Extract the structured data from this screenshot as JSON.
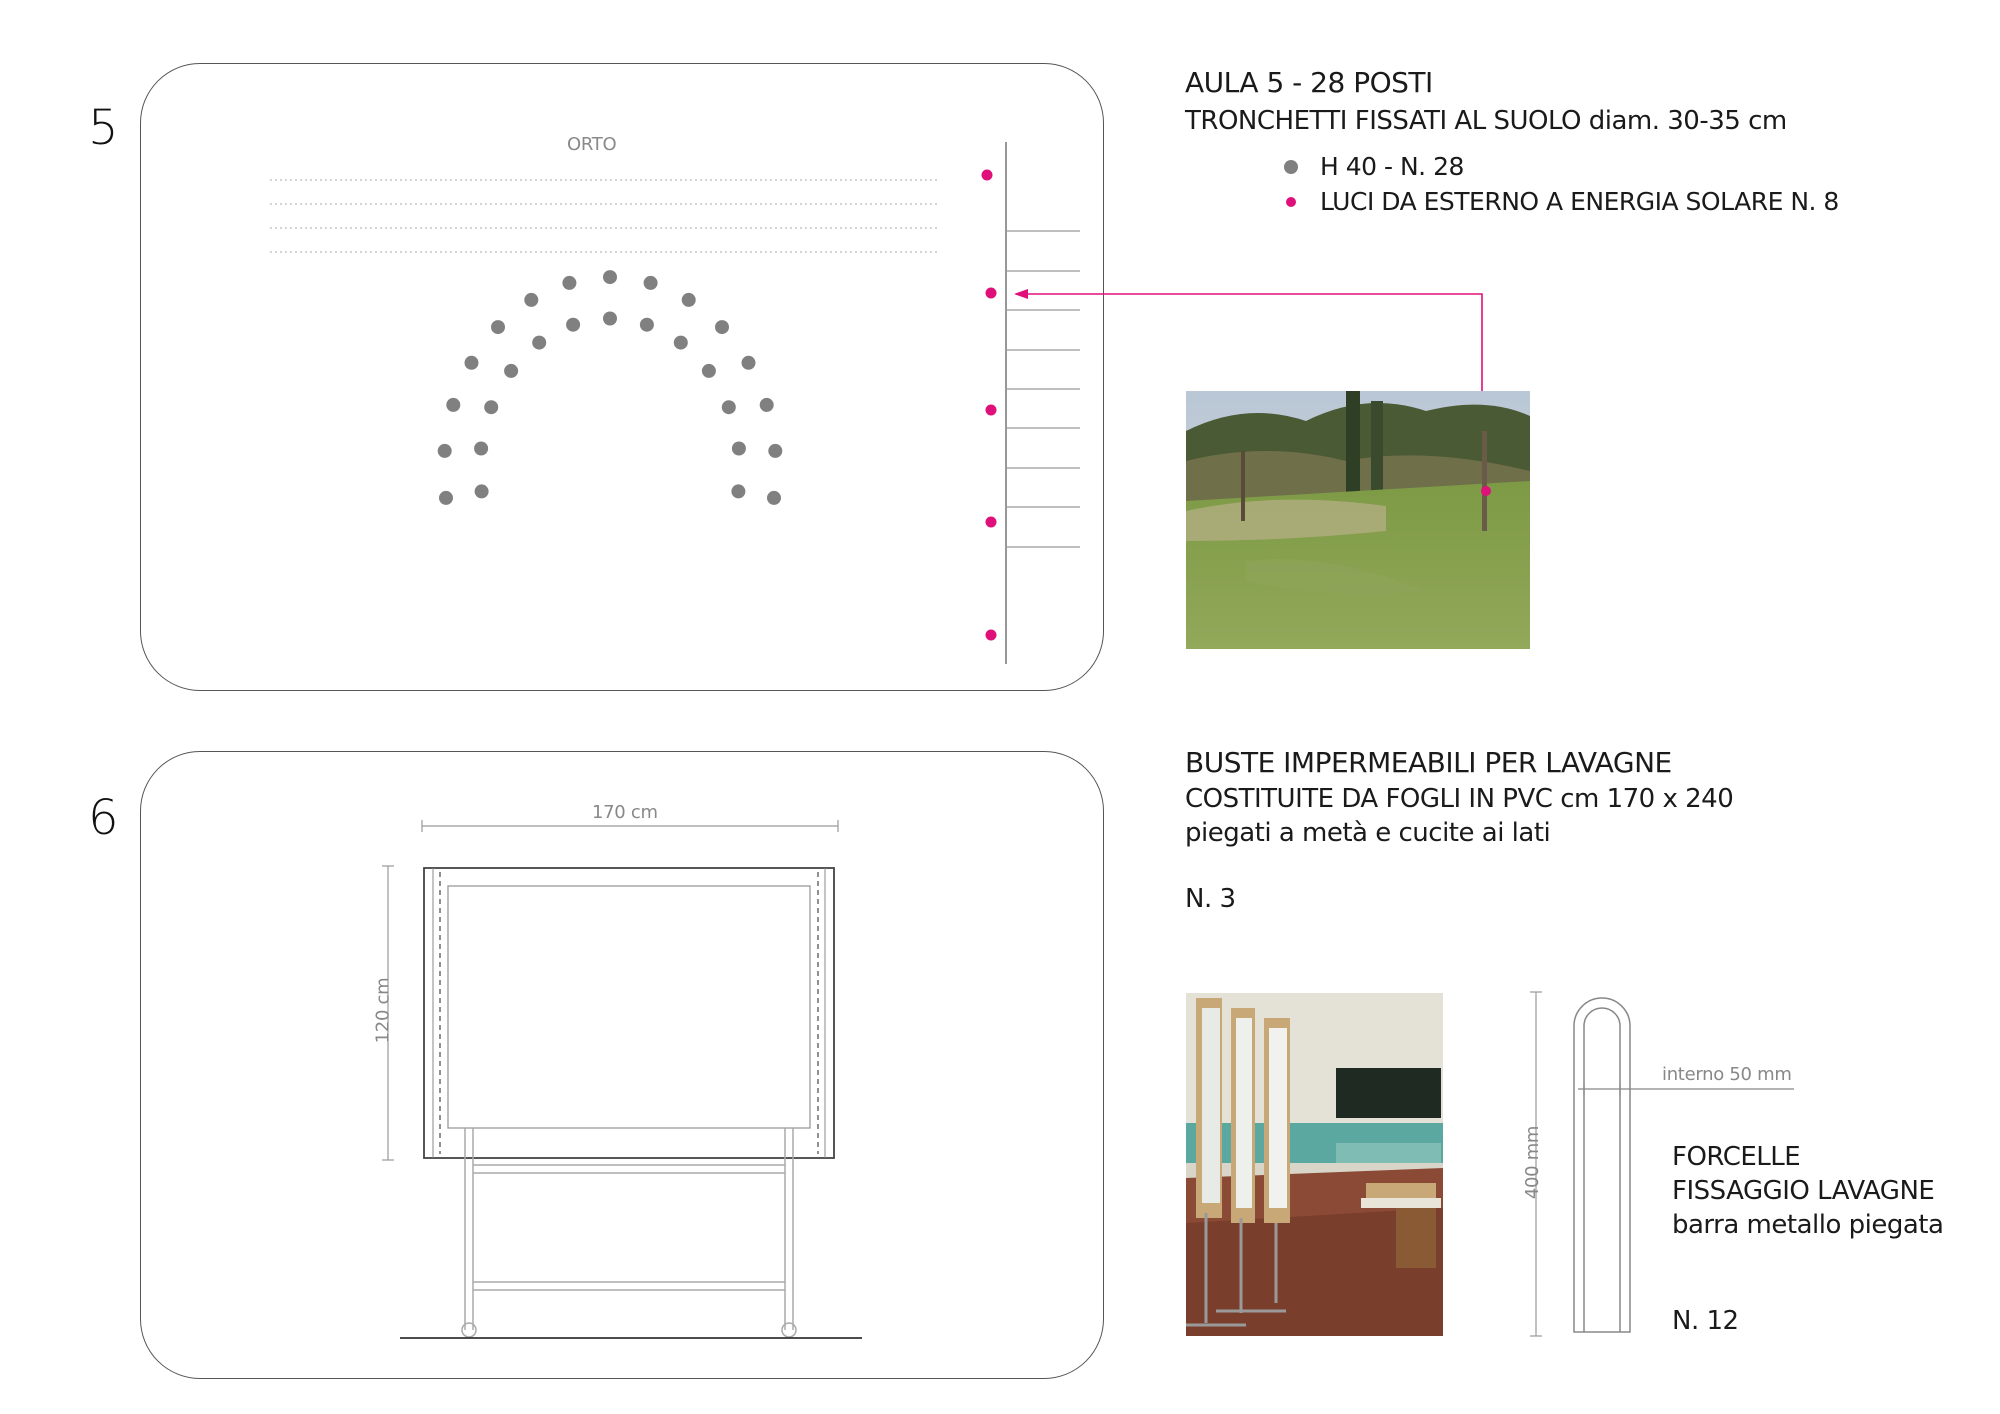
{
  "colors": {
    "seat": "#808080",
    "light": "#e0107a",
    "line": "#555555",
    "accent": "#e0107a"
  },
  "section5": {
    "number": "5",
    "title": "AULA 5 - 28 POSTI",
    "subtitle": "TRONCHETTI FISSATI AL SUOLO diam. 30-35 cm",
    "legend": [
      {
        "label": "H 40 - N. 28",
        "color": "#808080"
      },
      {
        "label": "LUCI DA ESTERNO A ENERGIA SOLARE N. 8",
        "color": "#e0107a"
      }
    ],
    "diagram": {
      "orto_label": "ORTO"
    }
  },
  "section6": {
    "number": "6",
    "title": "BUSTE IMPERMEABILI PER LAVAGNE",
    "line1": "COSTITUITE DA FOGLI IN PVC cm 170 x 240",
    "line2": "piegati a metà e cucite ai lati",
    "count": "N. 3",
    "diagram": {
      "width_label": "170 cm",
      "height_label": "120 cm"
    },
    "fork": {
      "height_label": "400 mm",
      "inner_label": "interno 50 mm",
      "title": "FORCELLE",
      "line1": "FISSAGGIO LAVAGNE",
      "line2": "barra metallo piegata",
      "count": "N. 12"
    }
  }
}
